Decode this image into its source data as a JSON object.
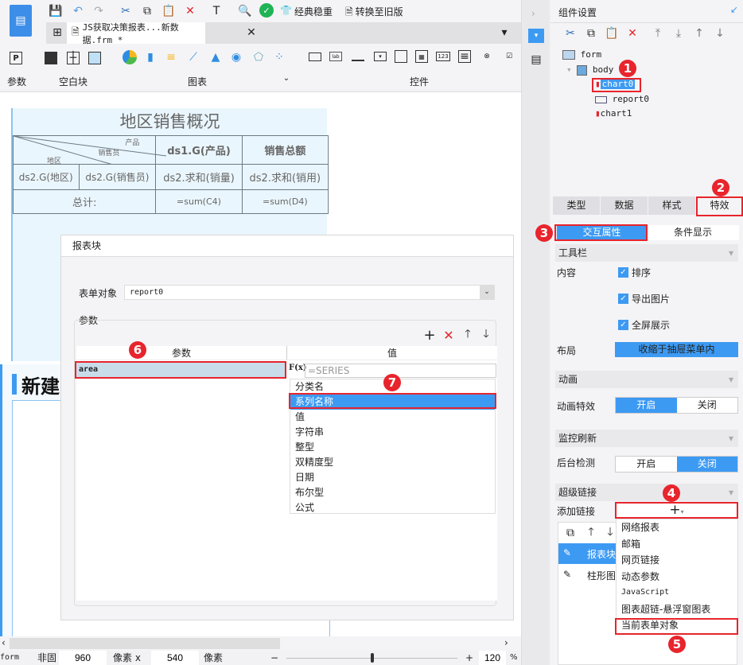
{
  "toolbar": {
    "classic_label": "经典稳重",
    "convert_label": "转换至旧版"
  },
  "tab": {
    "title": "JS获取决策报表...新数据.frm *"
  },
  "ribbon": {
    "groups": [
      "参数",
      "空白块",
      "图表",
      "控件"
    ]
  },
  "report": {
    "title": "地区销售概况",
    "diag": [
      "产品",
      "销售员",
      "地区"
    ],
    "h1": "ds1.G(产品)",
    "h2": "销售总额",
    "r1": [
      "ds2.G(地区)",
      "ds2.G(销售员)",
      "ds2.求和(销量)",
      "ds2.求和(销用)"
    ],
    "total": "总计:",
    "sum1": "=sum(C4)",
    "sum2": "=sum(D4)"
  },
  "new_block": "新建",
  "dialog": {
    "title": "报表块",
    "target_label": "表单对象",
    "target_value": "report0",
    "params_group": "参数",
    "col_param": "参数",
    "col_value": "值",
    "row_param": "area",
    "value_placeholder": "=SERIES",
    "fx": "F(x)",
    "options": [
      "分类名",
      "系列名称",
      "值",
      "字符串",
      "整型",
      "双精度型",
      "日期",
      "布尔型",
      "公式"
    ],
    "selected_option": "系列名称"
  },
  "status": {
    "form": "form",
    "label": "非固",
    "width": "960",
    "unit1": "像素 x",
    "height": "540",
    "unit2": "像素",
    "zoom": "120",
    "pct": "%",
    "zoom_level": 120
  },
  "panel": {
    "title": "组件设置",
    "tree": [
      "form",
      "body",
      "chart0",
      "report0",
      "chart1"
    ],
    "tabs": [
      "类型",
      "数据",
      "样式",
      "特效"
    ],
    "active_tab": "特效",
    "subtabs": [
      "交互属性",
      "条件显示"
    ],
    "toolbar_sec": "工具栏",
    "content_label": "内容",
    "checks": [
      "排序",
      "导出图片",
      "全屏展示"
    ],
    "layout_label": "布局",
    "layout_value": "收缩于抽屉菜单内",
    "anim_sec": "动画",
    "anim_label": "动画特效",
    "on": "开启",
    "off": "关闭",
    "monitor_sec": "监控刷新",
    "monitor_label": "后台检测",
    "link_sec": "超级链接",
    "add_link": "添加链接",
    "links": [
      "报表块",
      "柱形图"
    ],
    "menu": [
      "网络报表",
      "邮箱",
      "网页链接",
      "动态参数",
      "JavaScript",
      "图表超链-悬浮窗图表",
      "当前表单对象"
    ]
  },
  "badges": [
    "1",
    "2",
    "3",
    "4",
    "5",
    "6",
    "7"
  ],
  "colors": {
    "accent": "#3d9af2",
    "annotation": "#e8242c"
  }
}
